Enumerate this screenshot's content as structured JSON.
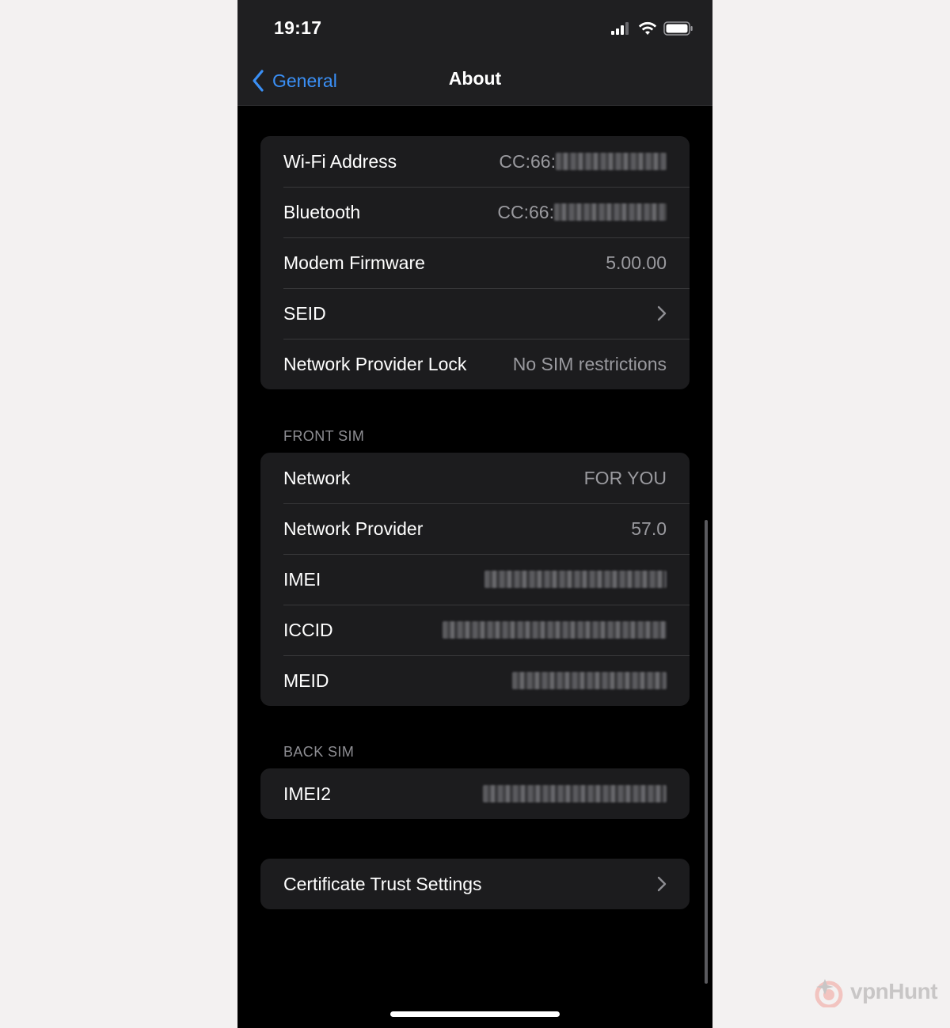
{
  "status_bar": {
    "time": "19:17"
  },
  "nav": {
    "back_label": "General",
    "title": "About"
  },
  "groups": {
    "device": [
      {
        "label": "Wi-Fi Address",
        "value": "CC:66:",
        "redacted": true
      },
      {
        "label": "Bluetooth",
        "value": "CC:66:",
        "redacted": true
      },
      {
        "label": "Modem Firmware",
        "value": "5.00.00"
      },
      {
        "label": "SEID",
        "value": ""
      },
      {
        "label": "Network Provider Lock",
        "value": "No SIM restrictions"
      }
    ],
    "front_sim": {
      "header": "FRONT SIM",
      "rows": [
        {
          "label": "Network",
          "value": "FOR YOU"
        },
        {
          "label": "Network Provider",
          "value": "57.0"
        },
        {
          "label": "IMEI",
          "value": "",
          "redacted": true
        },
        {
          "label": "ICCID",
          "value": "",
          "redacted": true
        },
        {
          "label": "MEID",
          "value": "",
          "redacted": true
        }
      ]
    },
    "back_sim": {
      "header": "BACK SIM",
      "rows": [
        {
          "label": "IMEI2",
          "value": "",
          "redacted": true
        }
      ]
    },
    "certificate": {
      "label": "Certificate Trust Settings"
    }
  },
  "watermark": {
    "text": "vpnHunt"
  },
  "colors": {
    "accent": "#3a8ff5",
    "group_bg": "#1c1c1e",
    "background": "#000000"
  }
}
